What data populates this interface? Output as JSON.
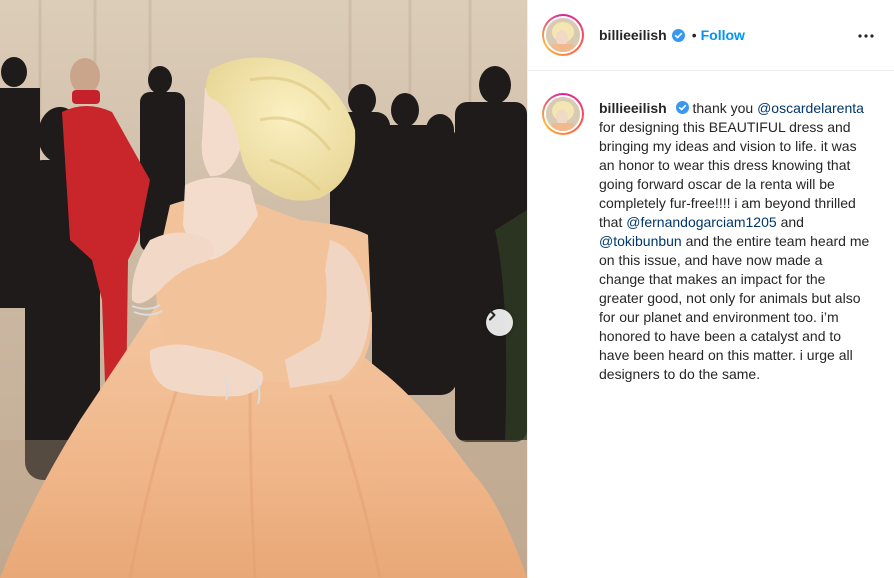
{
  "post": {
    "username": "billieeilish",
    "verified": true,
    "follow_separator": "•",
    "follow_label": "Follow",
    "caption": {
      "p1": "thank you",
      "m1": "@oscardelarenta",
      "p2": "for designing this BEAUTIFUL dress and bringing my ideas and vision to life. it was an honor to wear this dress knowing that going forward oscar de la renta will be completely fur-free!!!! i am beyond thrilled that",
      "m2": "@fernandogarciam1205",
      "p3": "and",
      "m3": "@tokibunbun",
      "p4": "and the entire team heard me on this issue, and have now made a change that makes an impact for the greater good, not only for animals but also for our planet and environment too. i’m honored to have been a catalyst and to have been heard on this matter. i urge all designers to do the same."
    }
  },
  "icons": {
    "verified": "verified-badge-icon",
    "more": "more-options-icon",
    "next": "chevron-right-icon"
  },
  "colors": {
    "link": "#0095f6",
    "mention": "#00376b",
    "verified": "#3897f0",
    "gown": "#f0b88c"
  }
}
